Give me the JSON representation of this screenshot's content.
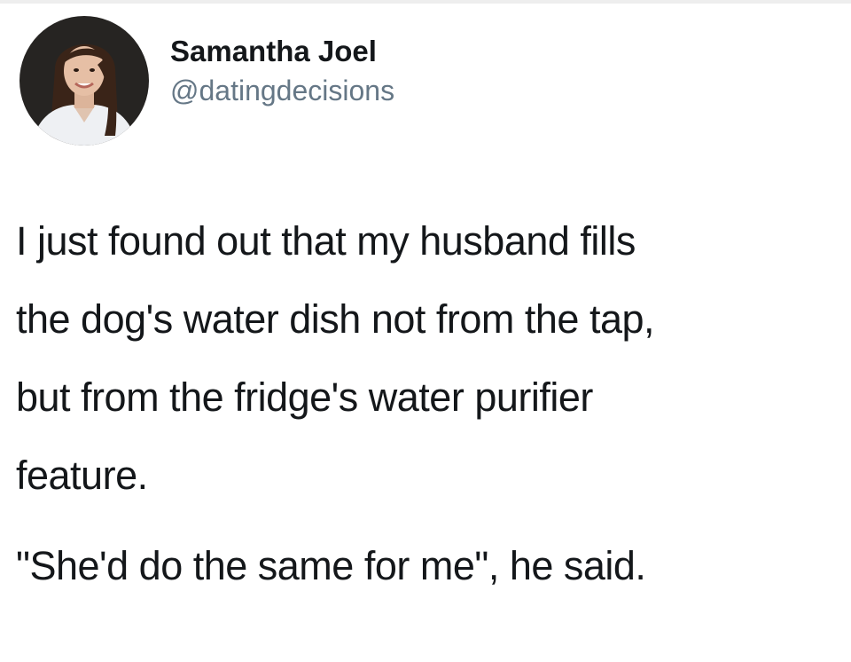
{
  "tweet": {
    "author": {
      "display_name": "Samantha Joel",
      "handle": "@datingdecisions",
      "avatar_icon": "profile-photo"
    },
    "text": {
      "paragraph_1": "I just found out that my husband fills\nthe dog's water dish not from the tap,\nbut from the fridge's water purifier\nfeature.",
      "paragraph_2": "\"She'd do the same for me\", he said."
    }
  },
  "colors": {
    "text": "#14171a",
    "handle": "#657786",
    "background": "#ffffff"
  }
}
